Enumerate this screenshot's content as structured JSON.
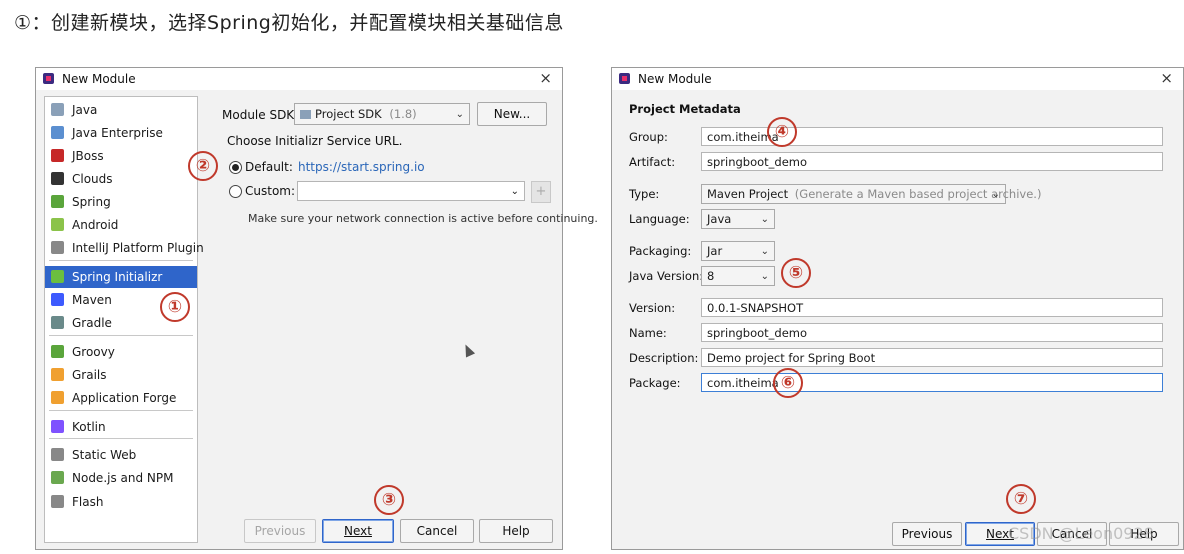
{
  "heading": "①：创建新模块，选择Spring初始化，并配置模块相关基础信息",
  "left_dialog": {
    "title": "New Module",
    "close": "×",
    "sidebar": [
      {
        "label": "Java",
        "icon": "folder-icon",
        "color": "#8aa0b8"
      },
      {
        "label": "Java Enterprise",
        "icon": "enterprise-icon",
        "color": "#5b8fd0"
      },
      {
        "label": "JBoss",
        "icon": "jboss-icon",
        "color": "#c62828"
      },
      {
        "label": "Clouds",
        "icon": "clouds-icon",
        "color": "#333333"
      },
      {
        "label": "Spring",
        "icon": "spring-icon",
        "color": "#5aa53b"
      },
      {
        "label": "Android",
        "icon": "android-icon",
        "color": "#8bc34a"
      },
      {
        "label": "IntelliJ Platform Plugin",
        "icon": "plugin-icon",
        "color": "#888888"
      },
      {
        "label": "Spring Initializr",
        "icon": "spring-initializr-icon",
        "color": "#6bbf3f"
      },
      {
        "label": "Maven",
        "icon": "maven-icon",
        "color": "#3d5afe"
      },
      {
        "label": "Gradle",
        "icon": "gradle-icon",
        "color": "#6a8a8a"
      },
      {
        "label": "Groovy",
        "icon": "groovy-icon",
        "color": "#5aa53b"
      },
      {
        "label": "Grails",
        "icon": "grails-icon",
        "color": "#f0a030"
      },
      {
        "label": "Application Forge",
        "icon": "forge-icon",
        "color": "#f0a030"
      },
      {
        "label": "Kotlin",
        "icon": "kotlin-icon",
        "color": "#7f52ff"
      },
      {
        "label": "Static Web",
        "icon": "static-web-icon",
        "color": "#888888"
      },
      {
        "label": "Node.js and NPM",
        "icon": "nodejs-icon",
        "color": "#6aa84f"
      },
      {
        "label": "Flash",
        "icon": "flash-icon",
        "color": "#888888"
      }
    ],
    "selected_index": 7,
    "module_sdk_label": "Module SDK:",
    "module_sdk_value": "Project SDK",
    "module_sdk_version": "(1.8)",
    "new_button": "New...",
    "choose_url_label": "Choose Initializr Service URL.",
    "default_label": "Default:",
    "default_url": "https://start.spring.io",
    "custom_label": "Custom:",
    "hint": "Make sure your network connection is active before continuing.",
    "buttons": {
      "previous": "Previous",
      "next": "Next",
      "cancel": "Cancel",
      "help": "Help"
    }
  },
  "right_dialog": {
    "title": "New Module",
    "close": "×",
    "section": "Project Metadata",
    "fields": {
      "group_label": "Group:",
      "group_value": "com.itheima",
      "artifact_label": "Artifact:",
      "artifact_value": "springboot_demo",
      "type_label": "Type:",
      "type_value": "Maven Project",
      "type_hint": "(Generate a Maven based project archive.)",
      "language_label": "Language:",
      "language_value": "Java",
      "packaging_label": "Packaging:",
      "packaging_value": "Jar",
      "java_version_label": "Java Version:",
      "java_version_value": "8",
      "version_label": "Version:",
      "version_value": "0.0.1-SNAPSHOT",
      "name_label": "Name:",
      "name_value": "springboot_demo",
      "description_label": "Description:",
      "description_value": "Demo project for Spring Boot",
      "package_label": "Package:",
      "package_value": "com.itheima"
    },
    "buttons": {
      "previous": "Previous",
      "next": "Next",
      "cancel": "Cancel",
      "help": "Help"
    }
  },
  "markers": [
    "①",
    "②",
    "③",
    "④",
    "⑤",
    "⑥",
    "⑦"
  ],
  "watermark": "CSDN @Leon0928",
  "accent_color": "#2f65ca",
  "marker_color": "#c0392b"
}
